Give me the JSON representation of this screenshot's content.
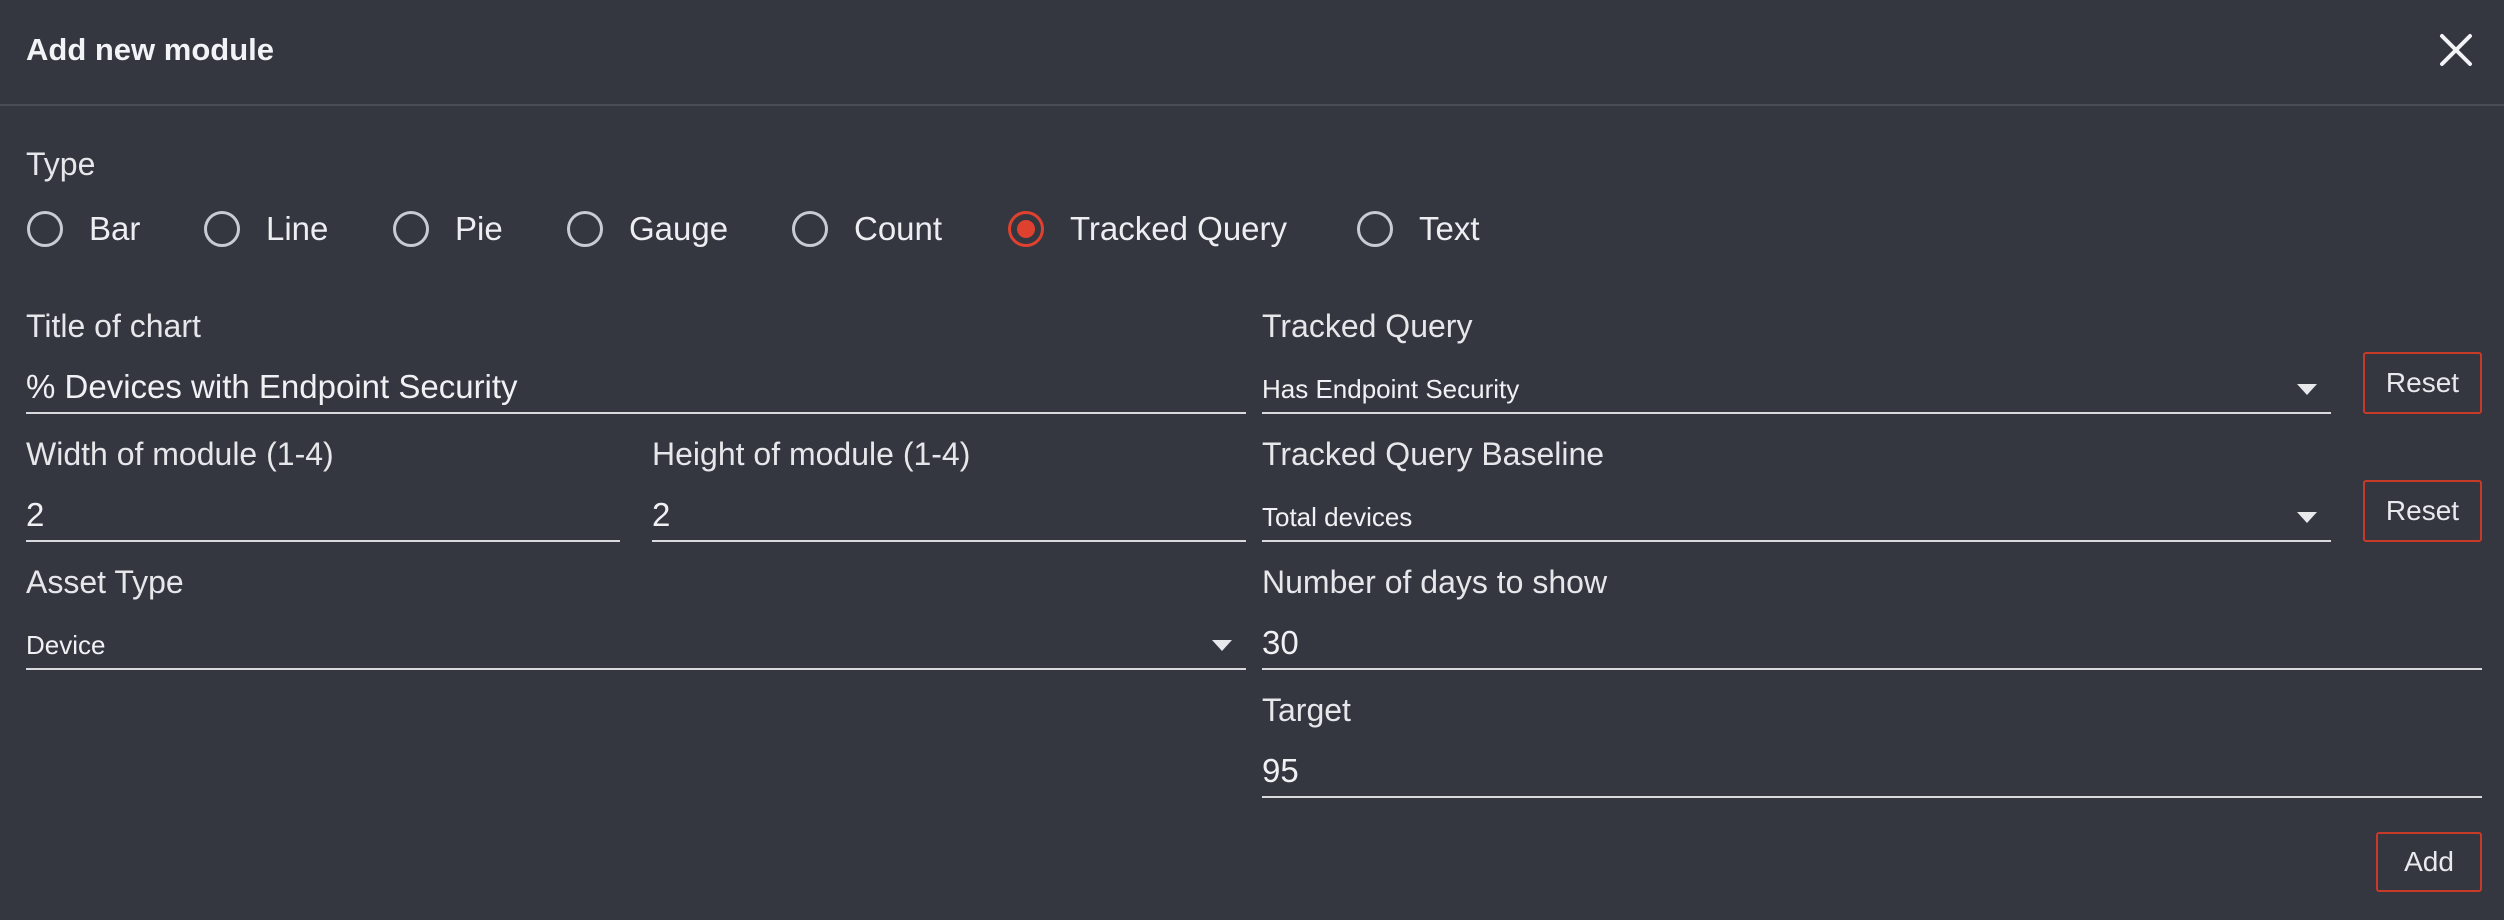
{
  "dialog": {
    "title": "Add new module"
  },
  "type_section": {
    "label": "Type",
    "options": [
      "Bar",
      "Line",
      "Pie",
      "Gauge",
      "Count",
      "Tracked Query",
      "Text"
    ],
    "selected": "Tracked Query"
  },
  "form": {
    "title_label": "Title of chart",
    "title_value": "% Devices with Endpoint Security",
    "width_label": "Width of module (1-4)",
    "width_value": "2",
    "height_label": "Height of module (1-4)",
    "height_value": "2",
    "asset_type_label": "Asset Type",
    "asset_type_value": "Device",
    "tracked_query_label": "Tracked Query",
    "tracked_query_value": "Has Endpoint Security",
    "baseline_label": "Tracked Query Baseline",
    "baseline_value": "Total devices",
    "days_label": "Number of days to show",
    "days_value": "30",
    "target_label": "Target",
    "target_value": "95"
  },
  "buttons": {
    "reset": "Reset",
    "add": "Add"
  },
  "colors": {
    "accent": "#e0402e",
    "background": "#343740"
  }
}
